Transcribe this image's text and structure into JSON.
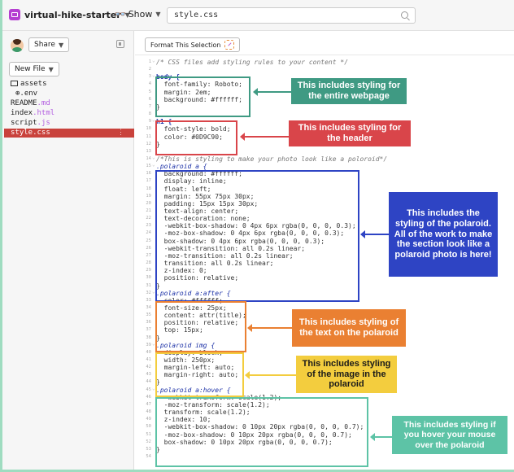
{
  "topbar": {
    "project_name": "virtual-hike-starter",
    "show_label": "Show",
    "file_search_value": "style.css"
  },
  "sidebar": {
    "share_label": "Share",
    "new_file_label": "New File",
    "files": [
      {
        "name": "assets",
        "ext": "",
        "kind": "folder"
      },
      {
        "name": "⊕.env",
        "ext": "",
        "kind": "env"
      },
      {
        "name": "README",
        "ext": ".md",
        "kind": "file"
      },
      {
        "name": "index",
        "ext": ".html",
        "kind": "file"
      },
      {
        "name": "script",
        "ext": ".js",
        "kind": "file"
      },
      {
        "name": "style.css",
        "ext": "",
        "kind": "active"
      }
    ],
    "active_dots": "⋮"
  },
  "editor": {
    "format_label": "Format This Selection",
    "lines": [
      {
        "n": "1",
        "text": "/* CSS files add styling rules to your content */",
        "cls": "cm",
        "fold": true
      },
      {
        "n": "2",
        "text": "",
        "cls": ""
      },
      {
        "n": "3",
        "text": "body {",
        "cls": "sel",
        "fold": true
      },
      {
        "n": "4",
        "text": "  font-family: Roboto;",
        "cls": ""
      },
      {
        "n": "5",
        "text": "  margin: 2em;",
        "cls": ""
      },
      {
        "n": "6",
        "text": "  background: #ffffff;",
        "cls": ""
      },
      {
        "n": "7",
        "text": "}",
        "cls": ""
      },
      {
        "n": "8",
        "text": "",
        "cls": ""
      },
      {
        "n": "9",
        "text": "h1 {",
        "cls": "sel",
        "fold": true
      },
      {
        "n": "10",
        "text": "  font-style: bold;",
        "cls": ""
      },
      {
        "n": "11",
        "text": "  color: #0D9C90;",
        "cls": ""
      },
      {
        "n": "12",
        "text": "}",
        "cls": ""
      },
      {
        "n": "13",
        "text": "",
        "cls": ""
      },
      {
        "n": "14",
        "text": "/*This is styling to make your photo look like a poloroid*/",
        "cls": "cm",
        "fold": true
      },
      {
        "n": "15",
        "text": ".polaroid a {",
        "cls": "selit",
        "fold": true
      },
      {
        "n": "16",
        "text": "  background: #ffffff;",
        "cls": ""
      },
      {
        "n": "17",
        "text": "  display: inline;",
        "cls": ""
      },
      {
        "n": "18",
        "text": "  float: left;",
        "cls": ""
      },
      {
        "n": "19",
        "text": "  margin: 55px 75px 30px;",
        "cls": ""
      },
      {
        "n": "20",
        "text": "  padding: 15px 15px 30px;",
        "cls": ""
      },
      {
        "n": "21",
        "text": "  text-align: center;",
        "cls": ""
      },
      {
        "n": "22",
        "text": "  text-decoration: none;",
        "cls": ""
      },
      {
        "n": "23",
        "text": "  -webkit-box-shadow: 0 4px 6px rgba(0, 0, 0, 0.3);",
        "cls": ""
      },
      {
        "n": "24",
        "text": "  -moz-box-shadow: 0 4px 6px rgba(0, 0, 0, 0.3);",
        "cls": ""
      },
      {
        "n": "25",
        "text": "  box-shadow: 0 4px 6px rgba(0, 0, 0, 0.3);",
        "cls": ""
      },
      {
        "n": "26",
        "text": "  -webkit-transition: all 0.2s linear;",
        "cls": ""
      },
      {
        "n": "27",
        "text": "  -moz-transition: all 0.2s linear;",
        "cls": ""
      },
      {
        "n": "28",
        "text": "  transition: all 0.2s linear;",
        "cls": ""
      },
      {
        "n": "29",
        "text": "  z-index: 0;",
        "cls": ""
      },
      {
        "n": "30",
        "text": "  position: relative;",
        "cls": ""
      },
      {
        "n": "31",
        "text": "}",
        "cls": ""
      },
      {
        "n": "32",
        "text": ".polaroid a:after {",
        "cls": "selit",
        "fold": true
      },
      {
        "n": "33",
        "text": "  color: #ffffff;",
        "cls": ""
      },
      {
        "n": "34",
        "text": "  font-size: 25px;",
        "cls": ""
      },
      {
        "n": "35",
        "text": "  content: attr(title);",
        "cls": ""
      },
      {
        "n": "36",
        "text": "  position: relative;",
        "cls": ""
      },
      {
        "n": "37",
        "text": "  top: 15px;",
        "cls": ""
      },
      {
        "n": "38",
        "text": "}",
        "cls": ""
      },
      {
        "n": "39",
        "text": ".polaroid img {",
        "cls": "selit",
        "fold": true
      },
      {
        "n": "40",
        "text": "  display: block;",
        "cls": ""
      },
      {
        "n": "41",
        "text": "  width: 250px;",
        "cls": ""
      },
      {
        "n": "42",
        "text": "  margin-left: auto;",
        "cls": ""
      },
      {
        "n": "43",
        "text": "  margin-right: auto;",
        "cls": ""
      },
      {
        "n": "44",
        "text": "}",
        "cls": ""
      },
      {
        "n": "45",
        "text": ".polaroid a:hover {",
        "cls": "selit",
        "fold": true
      },
      {
        "n": "46",
        "text": "  -webkit-transform: scale(1.2);",
        "cls": ""
      },
      {
        "n": "47",
        "text": "  -moz-transform: scale(1.2);",
        "cls": ""
      },
      {
        "n": "48",
        "text": "  transform: scale(1.2);",
        "cls": ""
      },
      {
        "n": "49",
        "text": "  z-index: 10;",
        "cls": ""
      },
      {
        "n": "50",
        "text": "  -webkit-box-shadow: 0 10px 20px rgba(0, 0, 0, 0.7);",
        "cls": ""
      },
      {
        "n": "51",
        "text": "  -moz-box-shadow: 0 10px 20px rgba(0, 0, 0, 0.7);",
        "cls": ""
      },
      {
        "n": "52",
        "text": "  box-shadow: 0 10px 20px rgba(0, 0, 0, 0.7);",
        "cls": ""
      },
      {
        "n": "53",
        "text": "}",
        "cls": ""
      },
      {
        "n": "54",
        "text": "",
        "cls": ""
      }
    ]
  },
  "annotations": {
    "body": {
      "text": "This includes styling for the entire webpage",
      "color": "#3f9a83"
    },
    "h1": {
      "text": "This includes styling for the header",
      "color": "#d9454a"
    },
    "polaroid": {
      "text": "This includes the styling of the polaroid.  All of the work to make the section look like a polaroid photo is here!",
      "color": "#2e44c4"
    },
    "after": {
      "text": "This includes styling of the text on the polaroid",
      "color": "#ea8032"
    },
    "img": {
      "text": "This includes styling of the image in the polaroid",
      "color": "#f3cd3e",
      "text_color": "#1a1a1a"
    },
    "hover": {
      "text": "This includes styling if you hover your mouse over the polaroid",
      "color": "#5dc3a6"
    }
  }
}
